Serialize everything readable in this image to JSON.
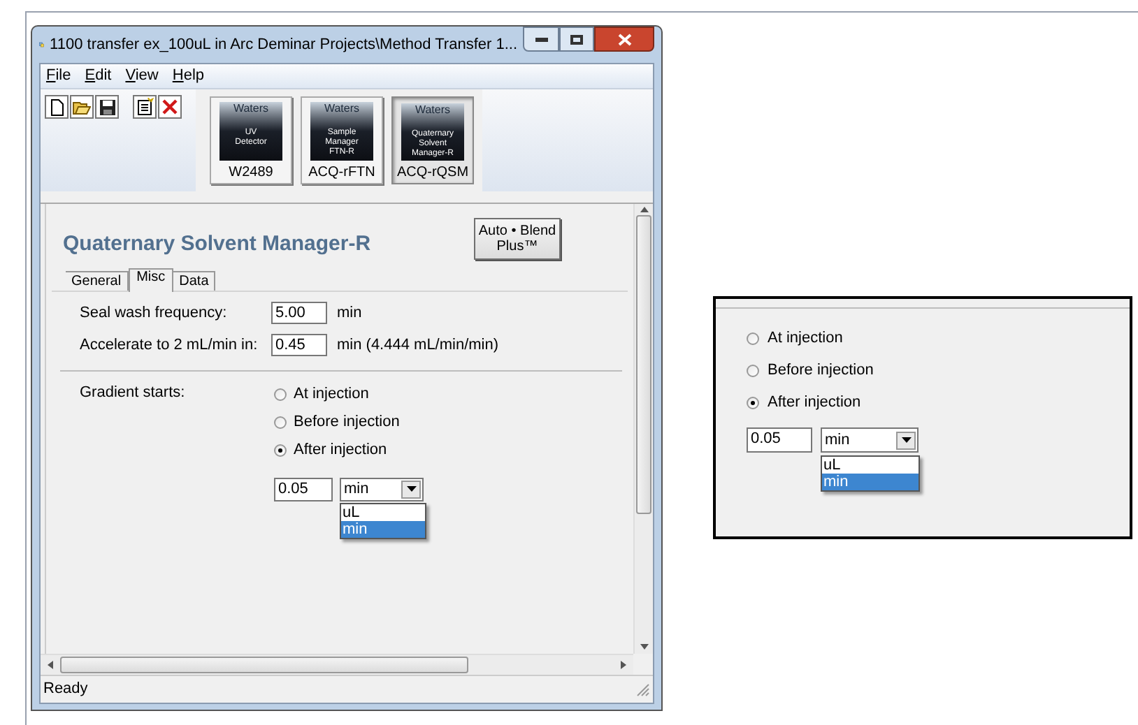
{
  "window": {
    "title": "1100 transfer ex_100uL in Arc Deminar Projects\\Method Transfer 1..."
  },
  "menu": [
    "File",
    "Edit",
    "View",
    "Help"
  ],
  "instruments": [
    {
      "logo_lines": [
        "Waters",
        "UV",
        "Detector"
      ],
      "label": "W2489",
      "selected": false
    },
    {
      "logo_lines": [
        "Waters",
        "Sample",
        "Manager",
        "FTN-R"
      ],
      "label": "ACQ-rFTN",
      "selected": false
    },
    {
      "logo_lines": [
        "Waters",
        "Quaternary",
        "Solvent",
        "Manager-R"
      ],
      "label": "ACQ-rQSM",
      "selected": true
    }
  ],
  "panel": {
    "title": "Quaternary Solvent Manager-R",
    "auto_blend_button": [
      "Auto • Blend",
      "Plus™"
    ],
    "tabs": [
      {
        "label": "General",
        "selected": false
      },
      {
        "label": "Misc",
        "selected": true
      },
      {
        "label": "Data",
        "selected": false
      }
    ],
    "fields": [
      {
        "label": "Seal wash frequency:",
        "value": "5.00",
        "unit": "min"
      },
      {
        "label": "Accelerate to 2 mL/min in:",
        "value": "0.45",
        "unit": "min (4.444 mL/min/min)"
      }
    ],
    "gradient": {
      "label": "Gradient starts:",
      "options": [
        {
          "label": "At injection",
          "selected": false
        },
        {
          "label": "Before injection",
          "selected": false
        },
        {
          "label": "After injection",
          "selected": true
        }
      ],
      "delay_value": "0.05",
      "unit": "min",
      "dropdown": [
        {
          "label": "uL",
          "selected": false
        },
        {
          "label": "min",
          "selected": true
        }
      ]
    }
  },
  "status_bar": "Ready",
  "inset": {
    "options": [
      {
        "label": "At injection",
        "selected": false
      },
      {
        "label": "Before injection",
        "selected": false
      },
      {
        "label": "After injection",
        "selected": true
      }
    ],
    "delay_value": "0.05",
    "unit": "min",
    "dropdown": [
      {
        "label": "uL",
        "selected": false
      },
      {
        "label": "min",
        "selected": true
      }
    ]
  }
}
